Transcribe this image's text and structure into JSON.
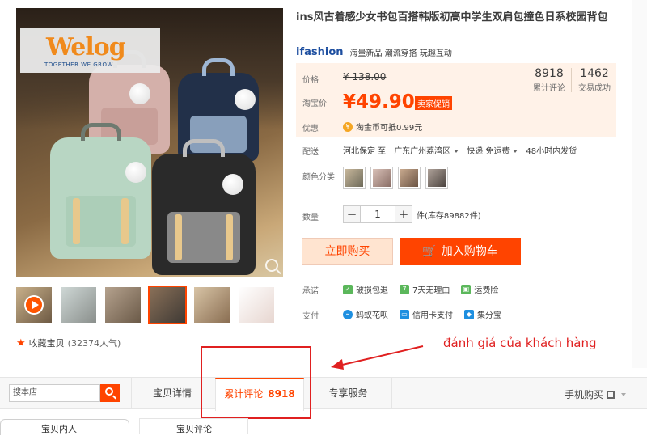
{
  "product": {
    "title": "ins风古着感少女书包百搭韩版初高中学生双肩包撞色日系校园背包",
    "brand_logo": "ifashion",
    "brand_tags": "海量新品  潮流穿搭  玩趣互动",
    "favorite_label": "收藏宝贝",
    "favorite_count": "(32374人气)",
    "logo_text": "Welog",
    "logo_tagline": "TOGETHER WE GROW"
  },
  "pricing": {
    "list_label": "价格",
    "list_price": "¥ 138.00",
    "sale_label": "淘宝价",
    "sale_price": "¥49.90",
    "promo_badge": "卖家促销",
    "reviews_count": "8918",
    "reviews_label": "累计评论",
    "sold_count": "1462",
    "sold_label": "交易成功",
    "benefit_label": "优惠",
    "coin_text": "淘金币可抵0.99元"
  },
  "delivery": {
    "label": "配送",
    "from": "河北保定 至",
    "to": "广东广州荔湾区",
    "shipping": "快递 免运费",
    "ship_time": "48小时内发货"
  },
  "options": {
    "color_label": "颜色分类",
    "swatch_colors": [
      "#8a8f6c",
      "#b9a496",
      "#a58a78",
      "#7c6e66"
    ]
  },
  "quantity": {
    "label": "数量",
    "value": "1",
    "minus": "−",
    "plus": "+",
    "stock": "件(库存89882件)"
  },
  "actions": {
    "buy_now": "立即购买",
    "add_to_cart": "加入购物车"
  },
  "promise": {
    "label": "承诺",
    "items": [
      "破损包退",
      "7天无理由",
      "运费险"
    ]
  },
  "payment": {
    "label": "支付",
    "items": [
      "蚂蚁花呗",
      "信用卡支付",
      "集分宝"
    ]
  },
  "annotation": {
    "text": "đánh giá của khách hàng"
  },
  "tabbar": {
    "search_value": "搜本店",
    "tab_details": "宝贝详情",
    "tab_reviews": "累计评论",
    "tab_reviews_count": "8918",
    "tab_service": "专享服务",
    "mobile_buy": "手机购买"
  },
  "bottom": {
    "stub1": "宝贝内人",
    "stub2": "宝贝评论"
  },
  "colors": {
    "accent": "#ff4400",
    "price_bg": "#fff2e8",
    "annotation": "#e02020"
  }
}
